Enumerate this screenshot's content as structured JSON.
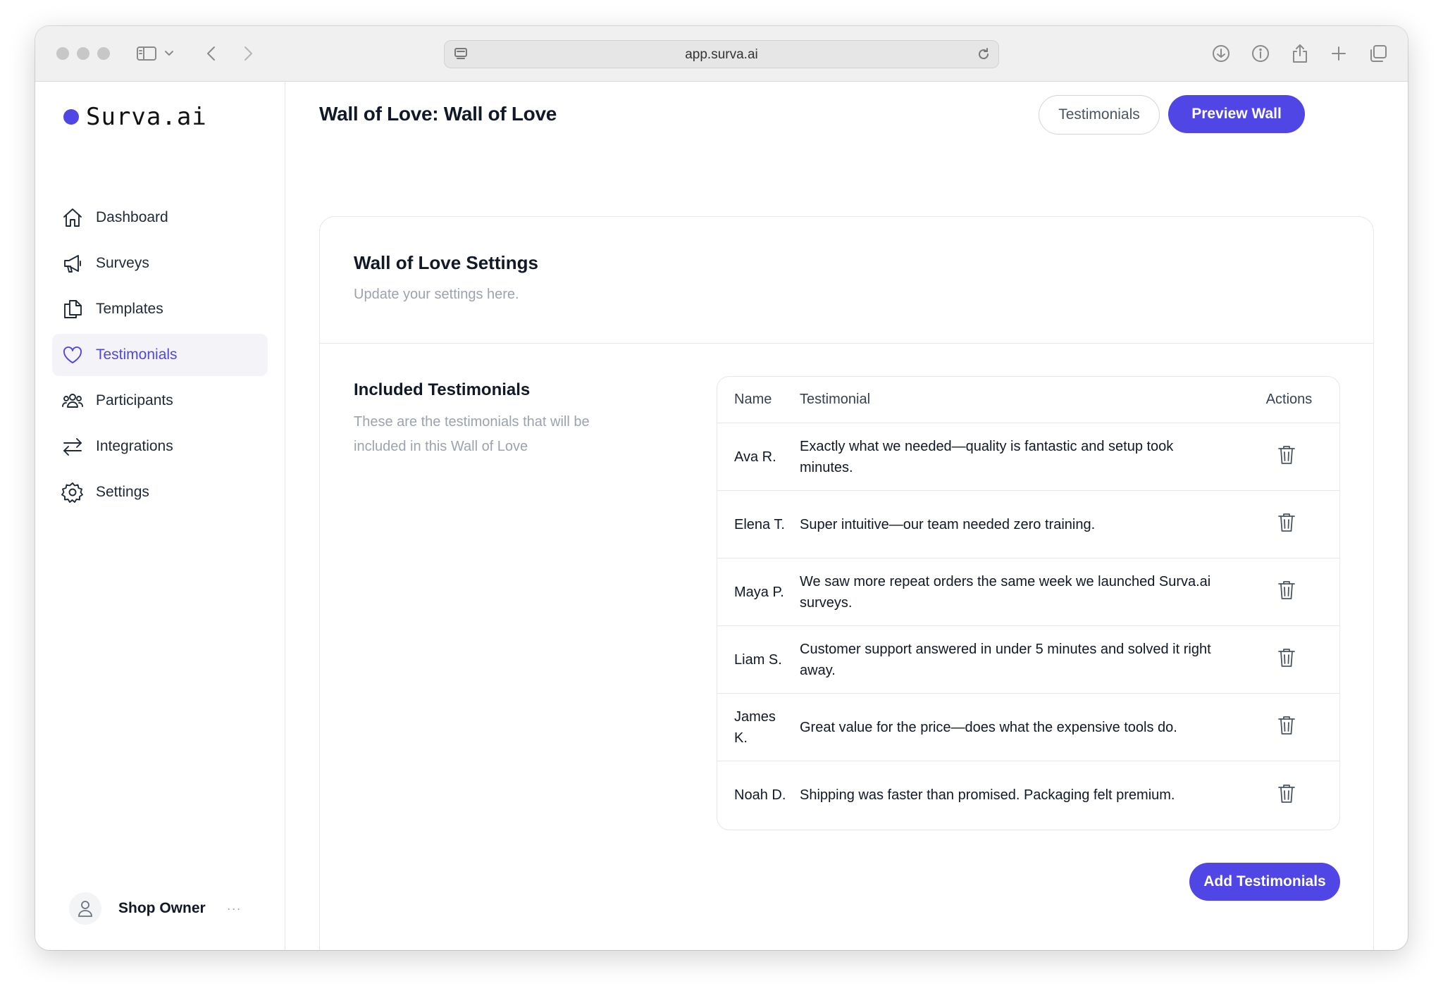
{
  "browser": {
    "url": "app.surva.ai"
  },
  "brand": {
    "name": "Surva.ai",
    "accent_color": "#4f46e5"
  },
  "sidebar": {
    "items": [
      {
        "label": "Dashboard",
        "icon": "home-icon",
        "active": false
      },
      {
        "label": "Surveys",
        "icon": "megaphone-icon",
        "active": false
      },
      {
        "label": "Templates",
        "icon": "documents-icon",
        "active": false
      },
      {
        "label": "Testimonials",
        "icon": "heart-icon",
        "active": true
      },
      {
        "label": "Participants",
        "icon": "users-icon",
        "active": false
      },
      {
        "label": "Integrations",
        "icon": "arrows-icon",
        "active": false
      },
      {
        "label": "Settings",
        "icon": "gear-icon",
        "active": false
      }
    ],
    "user": {
      "name": "Shop Owner",
      "more": "···"
    }
  },
  "header": {
    "title": "Wall of Love: Wall of Love",
    "testimonials_button": "Testimonials",
    "preview_button": "Preview Wall"
  },
  "settings": {
    "title": "Wall of Love Settings",
    "subtitle": "Update your settings here."
  },
  "included": {
    "title": "Included Testimonials",
    "description": "These are the testimonials that will be included in this Wall of Love",
    "columns": {
      "name": "Name",
      "testimonial": "Testimonial",
      "actions": "Actions"
    },
    "rows": [
      {
        "name": "Ava R.",
        "testimonial": "Exactly what we needed—quality is fantastic and setup took minutes."
      },
      {
        "name": "Elena T.",
        "testimonial": "Super intuitive—our team needed zero training."
      },
      {
        "name": "Maya P.",
        "testimonial": "We saw more repeat orders the same week we launched Surva.ai surveys."
      },
      {
        "name": "Liam S.",
        "testimonial": "Customer support answered in under 5 minutes and solved it right away."
      },
      {
        "name": "James K.",
        "testimonial": "Great value for the price—does what the expensive tools do."
      },
      {
        "name": "Noah D.",
        "testimonial": "Shipping was faster than promised. Packaging felt premium."
      }
    ],
    "add_button": "Add Testimonials"
  }
}
